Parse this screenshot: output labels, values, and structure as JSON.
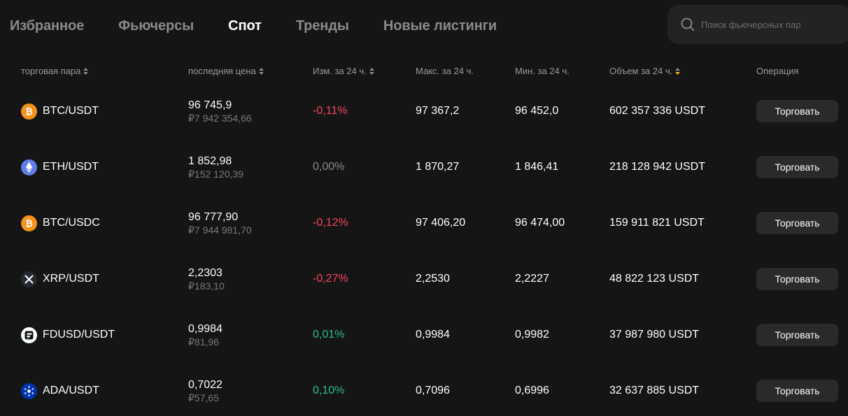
{
  "tabs": [
    "Избранное",
    "Фьючерсы",
    "Спот",
    "Тренды",
    "Новые листинги"
  ],
  "active_tab": 2,
  "search": {
    "placeholder": "Поиск фьючерсных пар"
  },
  "headers": {
    "pair": "торговая пара",
    "price": "последняя цена",
    "change": "Изм. за 24 ч.",
    "high": "Макс. за 24 ч.",
    "low": "Мин. за 24 ч.",
    "volume": "Объем за 24 ч.",
    "operation": "Операция"
  },
  "colors": {
    "background": "#151515",
    "negative": "#f6465d",
    "positive": "#2ebd85",
    "neutral": "#8a8a8a",
    "sort_active": "#f0b90b"
  },
  "rows": [
    {
      "pair": "BTC/USDT",
      "icon": "bitcoin-icon",
      "price": "96 745,9",
      "price_rub": "₽7 942 354,66",
      "change": "-0,11%",
      "trend": "neg",
      "high": "97 367,2",
      "low": "96 452,0",
      "volume": "602 357 336 USDT",
      "action": "Торговать"
    },
    {
      "pair": "ETH/USDT",
      "icon": "ethereum-icon",
      "price": "1 852,98",
      "price_rub": "₽152 120,39",
      "change": "0,00%",
      "trend": "neu",
      "high": "1 870,27",
      "low": "1 846,41",
      "volume": "218 128 942 USDT",
      "action": "Торговать"
    },
    {
      "pair": "BTC/USDC",
      "icon": "bitcoin-icon",
      "price": "96 777,90",
      "price_rub": "₽7 944 981,70",
      "change": "-0,12%",
      "trend": "neg",
      "high": "97 406,20",
      "low": "96 474,00",
      "volume": "159 911 821 USDT",
      "action": "Торговать"
    },
    {
      "pair": "XRP/USDT",
      "icon": "xrp-icon",
      "price": "2,2303",
      "price_rub": "₽183,10",
      "change": "-0,27%",
      "trend": "neg",
      "high": "2,2530",
      "low": "2,2227",
      "volume": "48 822 123 USDT",
      "action": "Торговать"
    },
    {
      "pair": "FDUSD/USDT",
      "icon": "fdusd-icon",
      "price": "0,9984",
      "price_rub": "₽81,96",
      "change": "0,01%",
      "trend": "pos",
      "high": "0,9984",
      "low": "0,9982",
      "volume": "37 987 980 USDT",
      "action": "Торговать"
    },
    {
      "pair": "ADA/USDT",
      "icon": "cardano-icon",
      "price": "0,7022",
      "price_rub": "₽57,65",
      "change": "0,10%",
      "trend": "pos",
      "high": "0,7096",
      "low": "0,6996",
      "volume": "32 637 885 USDT",
      "action": "Торговать"
    }
  ]
}
